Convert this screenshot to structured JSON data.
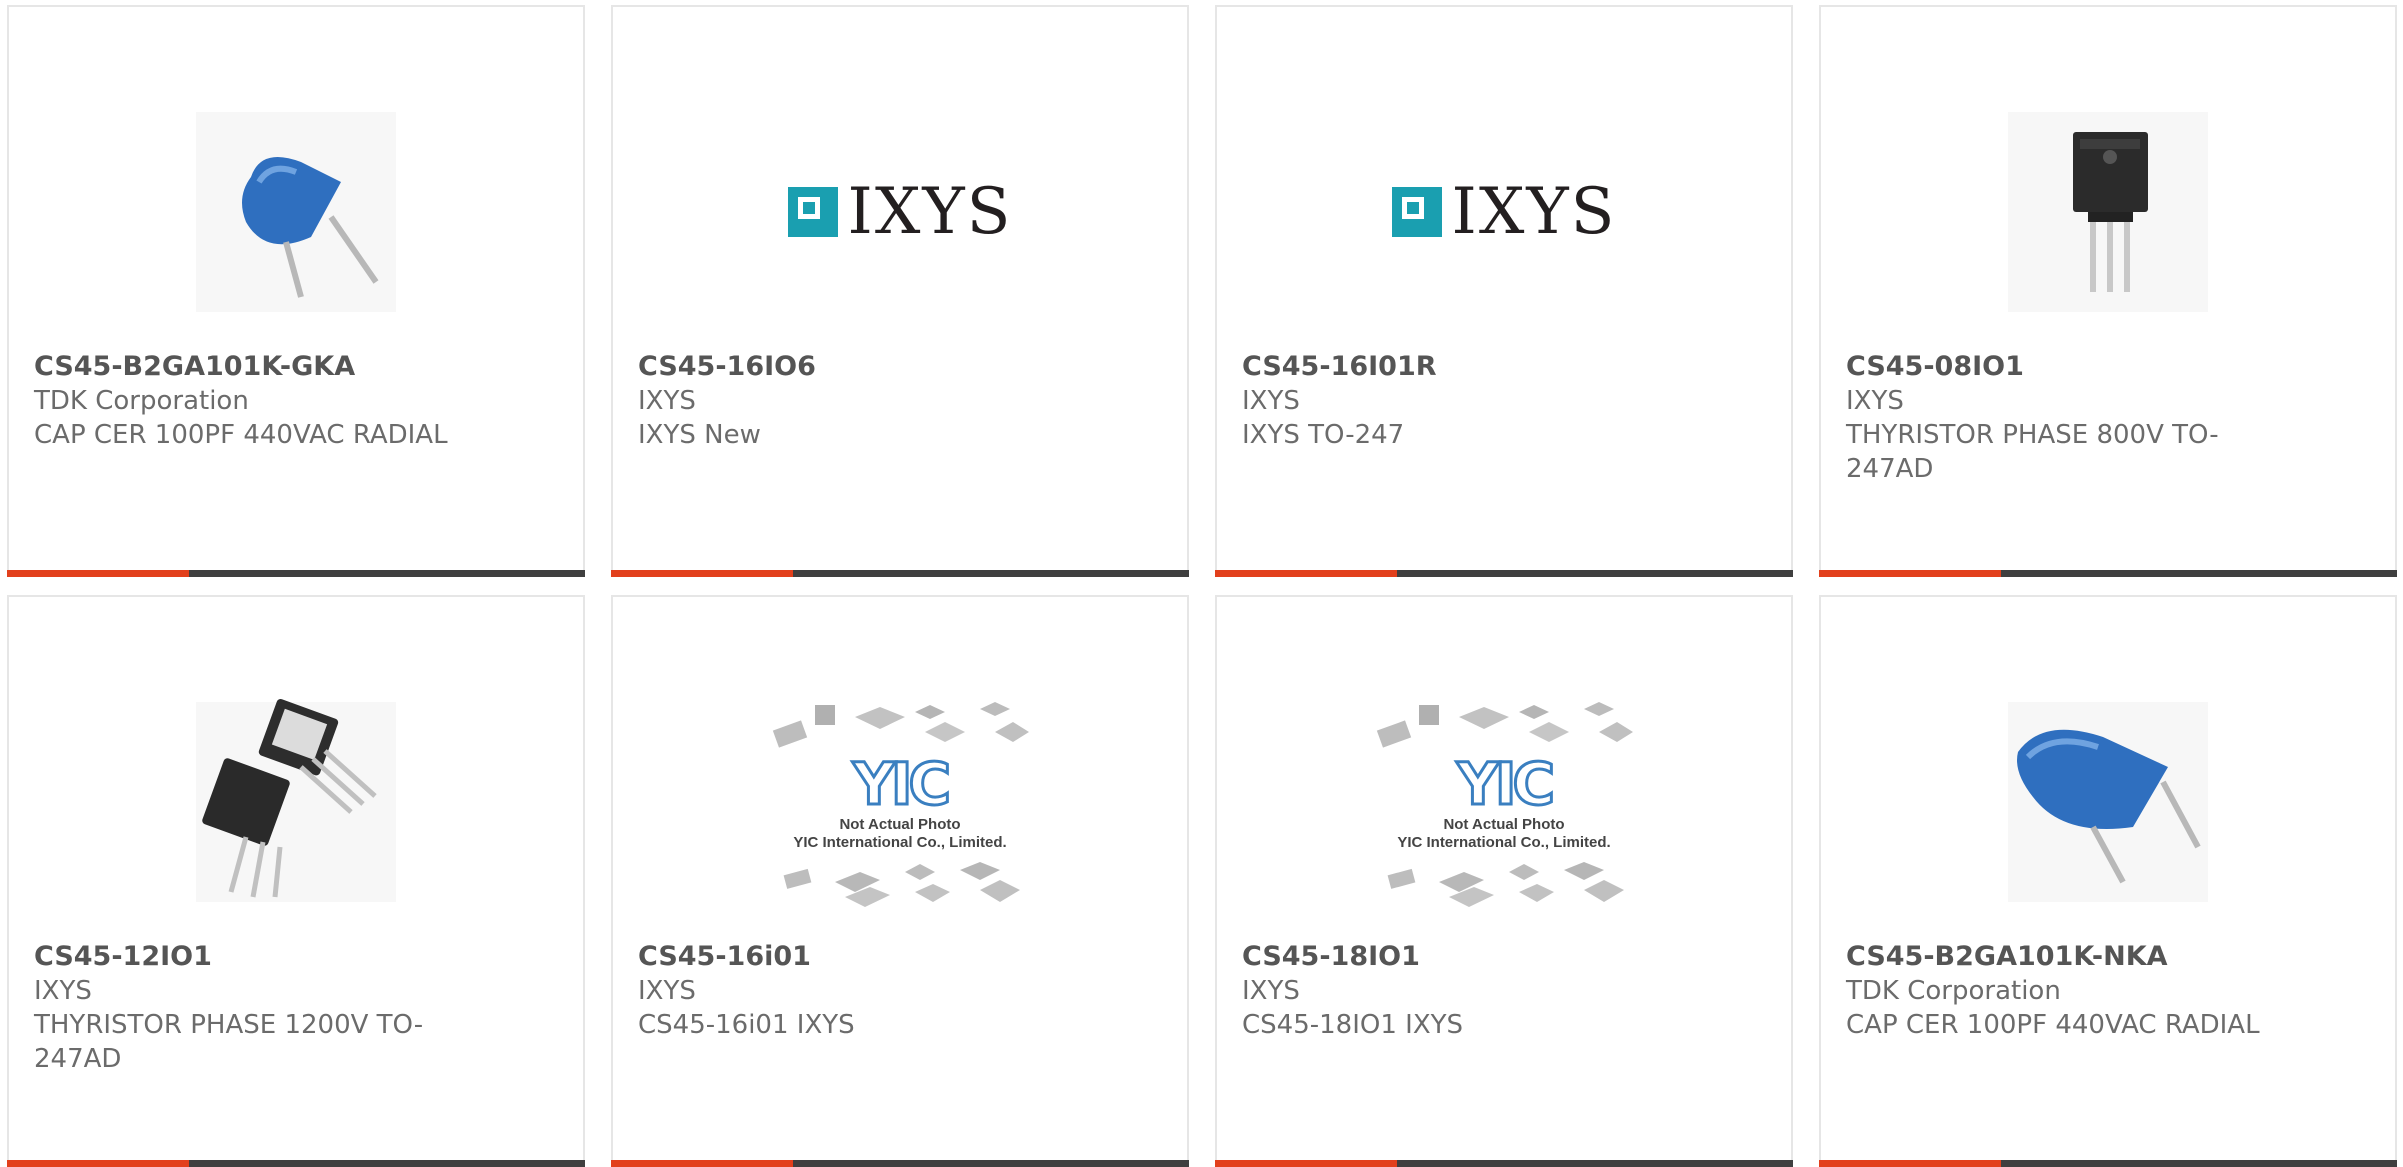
{
  "products": [
    {
      "part_number": "CS45-B2GA101K-GKA",
      "manufacturer": "TDK Corporation",
      "description": "CAP CER 100PF 440VAC RADIAL",
      "image": "ceramic-capacitor-image"
    },
    {
      "part_number": "CS45-16IO6",
      "manufacturer": "IXYS",
      "description": "IXYS New",
      "image": "ixys-logo"
    },
    {
      "part_number": "CS45-16I01R",
      "manufacturer": "IXYS",
      "description": "IXYS TO-247",
      "image": "ixys-logo"
    },
    {
      "part_number": "CS45-08IO1",
      "manufacturer": "IXYS",
      "description": "THYRISTOR PHASE 800V TO-247AD",
      "image": "to247-package-image"
    },
    {
      "part_number": "CS45-12IO1",
      "manufacturer": "IXYS",
      "description": "THYRISTOR PHASE 1200V TO-247AD",
      "image": "to247-two-packages-image"
    },
    {
      "part_number": "CS45-16i01",
      "manufacturer": "IXYS",
      "description": "CS45-16i01 IXYS",
      "image": "not-actual-photo-placeholder"
    },
    {
      "part_number": "CS45-18IO1",
      "manufacturer": "IXYS",
      "description": "CS45-18IO1 IXYS",
      "image": "not-actual-photo-placeholder"
    },
    {
      "part_number": "CS45-B2GA101K-NKA",
      "manufacturer": "TDK Corporation",
      "description": "CAP CER 100PF 440VAC RADIAL",
      "image": "ceramic-capacitor-image"
    }
  ],
  "logo": {
    "ixys_text": "IXYS",
    "yic_text": "YIC"
  },
  "placeholder": {
    "line1": "Not Actual Photo",
    "line2": "YIC International Co., Limited."
  },
  "colors": {
    "accent": "#e2401c",
    "bar": "#3f3f3f",
    "ixys_teal": "#1a9fb0",
    "capacitor_blue": "#2f6fbf"
  }
}
